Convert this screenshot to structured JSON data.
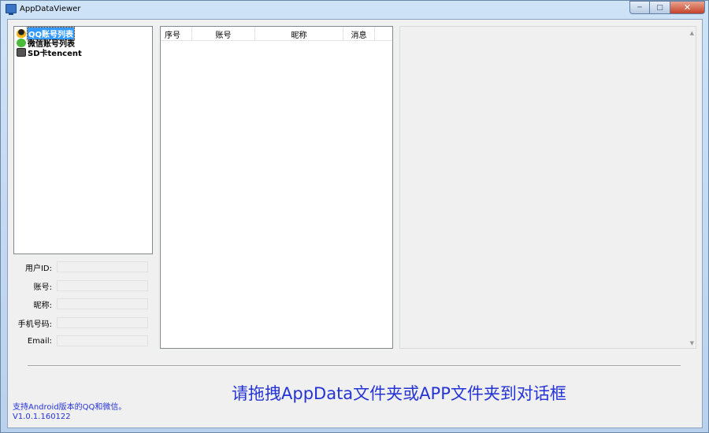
{
  "window": {
    "title": "AppDataViewer"
  },
  "tree": {
    "items": [
      {
        "label": "QQ账号列表",
        "icon": "qq-icon",
        "selected": true
      },
      {
        "label": "微信账号列表",
        "icon": "wechat-icon",
        "selected": false
      },
      {
        "label": "SD卡tencent",
        "icon": "sd-card-icon",
        "selected": false
      }
    ]
  },
  "fields": [
    {
      "label": "用户ID:",
      "value": ""
    },
    {
      "label": "账号:",
      "value": ""
    },
    {
      "label": "昵称:",
      "value": ""
    },
    {
      "label": "手机号码:",
      "value": ""
    },
    {
      "label": "Email:",
      "value": ""
    }
  ],
  "list": {
    "columns": [
      "序号",
      "账号",
      "昵称",
      "消息"
    ]
  },
  "hint": "请拖拽AppData文件夹或APP文件夹到对话框",
  "footer": {
    "support": "支持Android版本的QQ和微信。",
    "version": "V1.0.1.160122"
  },
  "colors": {
    "hint_text": "#2433d6",
    "selection": "#3399ff"
  }
}
